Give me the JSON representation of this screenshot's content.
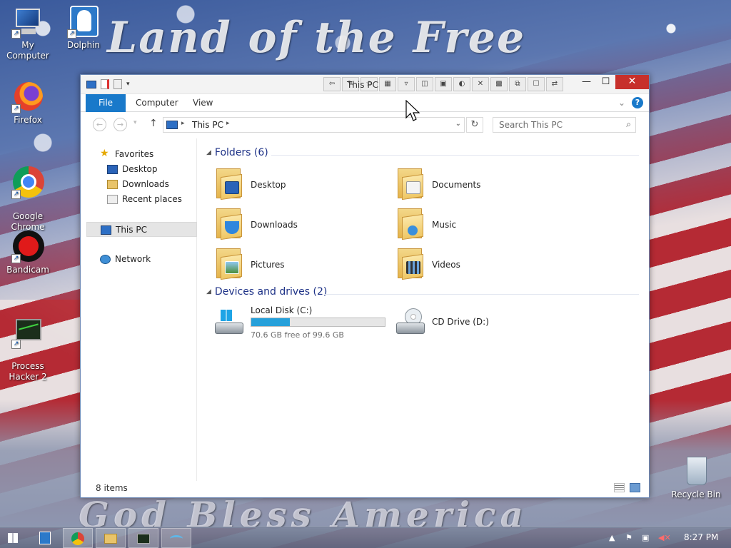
{
  "wallpaper": {
    "top_text": "Land of the Free",
    "bottom_text": "God Bless America"
  },
  "desktop_icons": [
    {
      "label": "My Computer",
      "icon": "my-computer-icon"
    },
    {
      "label": "Dolphin",
      "icon": "dolphin-icon"
    },
    {
      "label": "Firefox",
      "icon": "firefox-icon"
    },
    {
      "label": "Google\nChrome",
      "icon": "chrome-icon"
    },
    {
      "label": "Bandicam",
      "icon": "bandicam-icon"
    },
    {
      "label": "Process\nHacker 2",
      "icon": "process-hacker-icon"
    },
    {
      "label": "Recycle Bin",
      "icon": "recycle-bin-icon"
    }
  ],
  "window": {
    "title": "This PC",
    "controls": {
      "minimize": "—",
      "maximize": "☐",
      "close": "✕"
    }
  },
  "ribbon": {
    "tabs": [
      {
        "label": "File"
      },
      {
        "label": "Computer"
      },
      {
        "label": "View"
      }
    ],
    "help": "?"
  },
  "navbar": {
    "address_path": "This PC",
    "search_placeholder": "Search This PC"
  },
  "navpane": {
    "favorites": "Favorites",
    "favorites_items": [
      "Desktop",
      "Downloads",
      "Recent places"
    ],
    "this_pc": "This PC",
    "network": "Network"
  },
  "main": {
    "folders_header": "Folders (6)",
    "folders": [
      {
        "name": "Desktop",
        "icon": "desktop-folder-icon"
      },
      {
        "name": "Documents",
        "icon": "documents-folder-icon"
      },
      {
        "name": "Downloads",
        "icon": "downloads-folder-icon"
      },
      {
        "name": "Music",
        "icon": "music-folder-icon"
      },
      {
        "name": "Pictures",
        "icon": "pictures-folder-icon"
      },
      {
        "name": "Videos",
        "icon": "videos-folder-icon"
      }
    ],
    "drives_header": "Devices and drives (2)",
    "drives": [
      {
        "name": "Local Disk (C:)",
        "free_text": "70.6 GB free of 99.6 GB",
        "used_fraction": 0.29,
        "icon": "hard-drive-icon"
      },
      {
        "name": "CD Drive (D:)",
        "icon": "cd-drive-icon"
      }
    ]
  },
  "statusbar": {
    "items_text": "8 items"
  },
  "taskbar": {
    "clock": "8:27 PM",
    "apps": [
      "start-icon",
      "dolphin-icon",
      "chrome-icon",
      "file-explorer-icon",
      "process-hacker-icon",
      "dolphin-alt-icon"
    ]
  },
  "colors": {
    "accent": "#1979ca",
    "close": "#c7302b",
    "drive_bar": "#26a0da",
    "group_header": "#1e3287"
  }
}
